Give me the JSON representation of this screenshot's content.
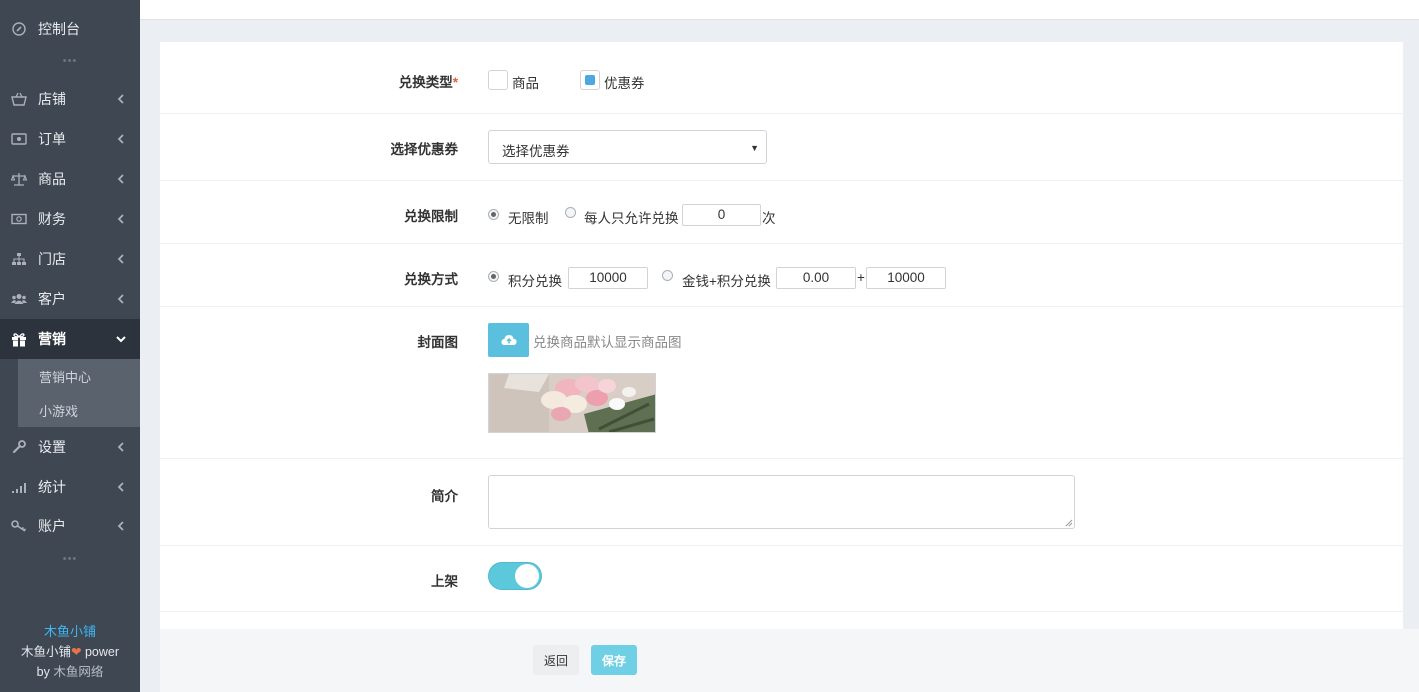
{
  "sidebar": {
    "console": "控制台",
    "items": [
      {
        "label": "店铺",
        "icon": "basket-icon"
      },
      {
        "label": "订单",
        "icon": "order-icon"
      },
      {
        "label": "商品",
        "icon": "scale-icon"
      },
      {
        "label": "财务",
        "icon": "money-icon"
      },
      {
        "label": "门店",
        "icon": "sitemap-icon"
      },
      {
        "label": "客户",
        "icon": "users-icon"
      },
      {
        "label": "营销",
        "icon": "gift-icon"
      },
      {
        "label": "设置",
        "icon": "wrench-icon"
      },
      {
        "label": "统计",
        "icon": "signal-icon"
      },
      {
        "label": "账户",
        "icon": "key-icon"
      }
    ],
    "sub_items": [
      "营销中心",
      "小游戏"
    ],
    "brand": {
      "name": "木鱼小铺",
      "line2_a": "木鱼小铺",
      "line2_b": " power",
      "line3_a": "by ",
      "line3_b": "木鱼网络"
    }
  },
  "form": {
    "exchange_type": {
      "label": "兑换类型",
      "required_mark": "*",
      "options": [
        {
          "label": "商品",
          "checked": false
        },
        {
          "label": "优惠券",
          "checked": true
        }
      ]
    },
    "coupon": {
      "label": "选择优惠券",
      "selected": "选择优惠券"
    },
    "limit": {
      "label": "兑换限制",
      "opt_unlimited": "无限制",
      "opt_per_person": "每人只允许兑换",
      "count": "0",
      "unit": "次",
      "selected": "unlimited"
    },
    "method": {
      "label": "兑换方式",
      "opt_points": "积分兑换",
      "points_value": "10000",
      "opt_money_points": "金钱+积分兑换",
      "money_value": "0.00",
      "plus": "+",
      "money_points_value": "10000",
      "selected": "points"
    },
    "cover": {
      "label": "封面图",
      "hint": "兑换商品默认显示商品图"
    },
    "intro": {
      "label": "简介",
      "value": ""
    },
    "listed": {
      "label": "上架",
      "on": true
    }
  },
  "footer": {
    "back": "返回",
    "save": "保存"
  },
  "colors": {
    "sidebar_bg": "#3f4753",
    "accent": "#5bc0de",
    "brand_blue": "#3eb6f0",
    "required": "#e85c3a"
  }
}
